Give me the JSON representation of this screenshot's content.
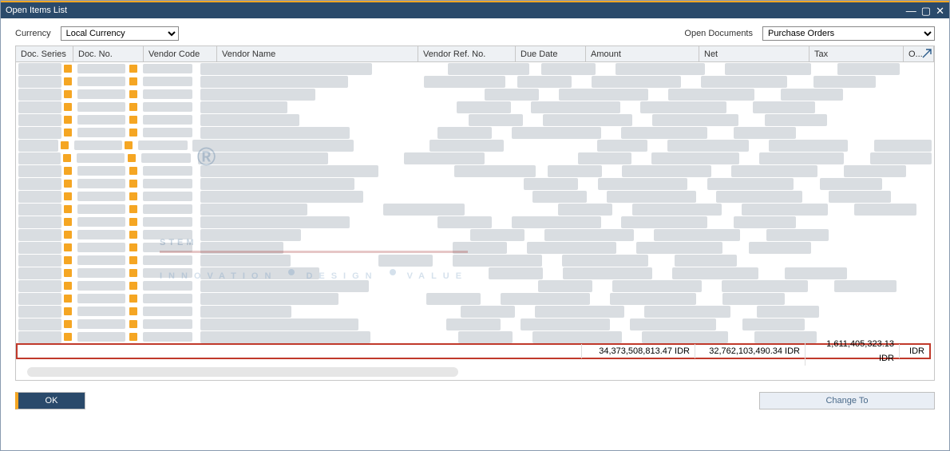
{
  "window": {
    "title": "Open Items List"
  },
  "toolbar": {
    "currency_label": "Currency",
    "currency_value": "Local Currency",
    "opendocs_label": "Open Documents",
    "opendocs_value": "Purchase Orders"
  },
  "columns": {
    "doc_series": "Doc. Series",
    "doc_no": "Doc. No.",
    "vendor_code": "Vendor Code",
    "vendor_name": "Vendor Name",
    "vendor_ref": "Vendor Ref. No.",
    "due_date": "Due Date",
    "amount": "Amount",
    "net": "Net",
    "tax": "Tax",
    "overflow": "O..."
  },
  "totals": {
    "amount": "34,373,508,813.47 IDR",
    "net": "32,762,103,490.34 IDR",
    "tax": "1,611,405,323.13 IDR",
    "extra": "IDR"
  },
  "footer": {
    "ok": "OK",
    "change_to": "Change To"
  },
  "colwidths": {
    "doc_series": 72,
    "doc_no": 88,
    "vendor_code": 92,
    "vendor_name": 252,
    "vendor_ref": 122,
    "due_date": 88,
    "amount": 142,
    "net": 138,
    "tax": 118,
    "overflow": 38
  },
  "watermark": {
    "brand": "STEM",
    "reg": "®",
    "tagline_a": "INNOVATION",
    "tagline_b": "DESIGN",
    "tagline_c": "VALUE"
  }
}
